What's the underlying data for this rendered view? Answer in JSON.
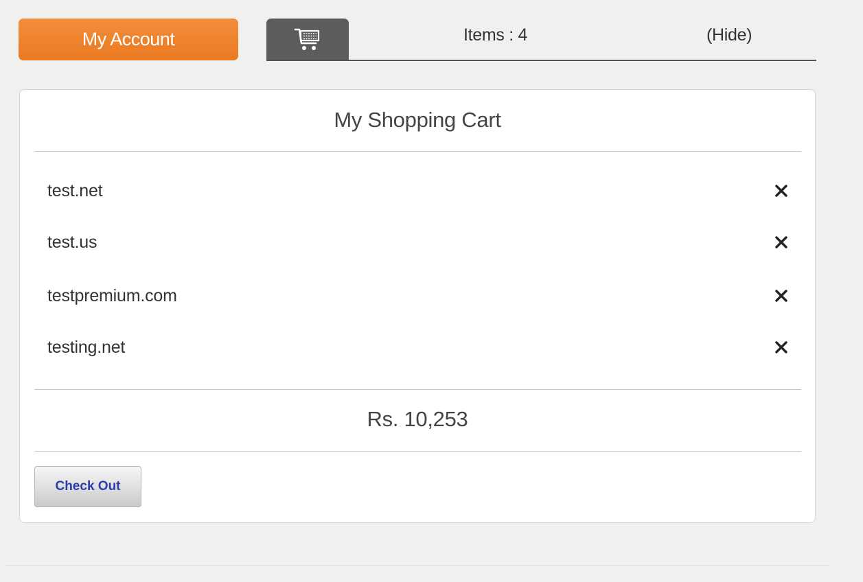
{
  "header": {
    "account_label": "My Account",
    "cart_icon": "shopping-cart-icon",
    "items_label": "Items : 4",
    "hide_label": "(Hide)"
  },
  "cart": {
    "title": "My Shopping Cart",
    "items": [
      {
        "name": "test.net",
        "remove_icon": "close-icon"
      },
      {
        "name": "test.us",
        "remove_icon": "close-icon"
      },
      {
        "name": "testpremium.com",
        "remove_icon": "close-icon"
      },
      {
        "name": "testing.net",
        "remove_icon": "close-icon"
      }
    ],
    "total": "Rs. 10,253",
    "checkout_label": "Check Out"
  },
  "colors": {
    "accent": "#ef8530",
    "tab": "#5c5c5c",
    "checkout_text": "#2c3da8"
  }
}
